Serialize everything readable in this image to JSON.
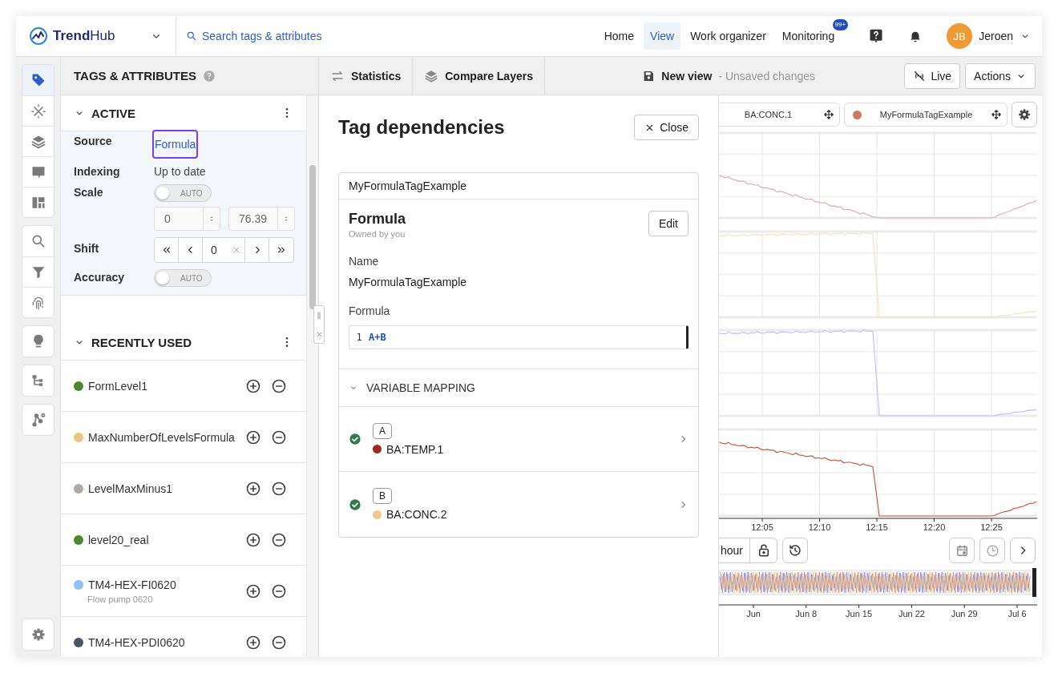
{
  "topbar": {
    "brand": "**Trend**Hub",
    "search": "Search tags & attributes",
    "nav": [
      {
        "label": "Home",
        "selected": false
      },
      {
        "label": "View",
        "selected": true
      },
      {
        "label": "Work organizer",
        "selected": false
      },
      {
        "label": "Monitoring",
        "selected": false,
        "badge": "99+"
      }
    ],
    "user": {
      "initials": "JB",
      "name": "Jeroen"
    }
  },
  "rail": {
    "groups": [
      [
        {
          "selected": true
        },
        {
          "selected": false
        },
        {
          "selected": false
        },
        {
          "selected": false
        },
        {
          "selected": false
        }
      ],
      [
        {
          "selected": false
        },
        {
          "selected": false
        },
        {
          "selected": false
        }
      ],
      [
        {
          "selected": false
        }
      ],
      [
        {
          "selected": false
        }
      ],
      [
        {
          "selected": false
        }
      ],
      [
        {
          "selected": false
        }
      ]
    ]
  },
  "tags_panel": {
    "title": "TAGS & ATTRIBUTES",
    "active": {
      "title": "ACTIVE",
      "expanded": true,
      "properties": [
        {
          "kind": "link",
          "label": "Source",
          "value": "Formula",
          "focused": true
        },
        {
          "kind": "text",
          "label": "Indexing",
          "value": "Up to date"
        },
        {
          "kind": "scale",
          "label": "Scale",
          "toggle": "AUTO",
          "on": false,
          "min": "0",
          "max": "76.39"
        },
        {
          "kind": "shift",
          "label": "Shift",
          "value": "0"
        },
        {
          "kind": "toggle",
          "label": "Accuracy",
          "toggle": "AUTO",
          "on": false
        }
      ]
    },
    "recent": {
      "title": "RECENTLY USED",
      "expanded": true,
      "items": [
        {
          "name": "FormLevel1",
          "color": "#4a8a2a"
        },
        {
          "name": "MaxNumberOfLevelsFormula",
          "color": "#e8c878"
        },
        {
          "name": "LevelMaxMinus1",
          "color": "#b0aaa6"
        },
        {
          "name": "level20_real",
          "color": "#4a8a2a"
        },
        {
          "name": "TM4-HEX-FI0620",
          "description": "Flow pump 0620",
          "color": "#8ec0f8"
        },
        {
          "name": "TM4-HEX-PDI0620",
          "color": "#4a5560"
        }
      ]
    }
  },
  "toolbar": {
    "tabs": [
      {
        "label": "Statistics"
      },
      {
        "label": "Compare Layers"
      }
    ],
    "view": {
      "name": "New view",
      "status": "- Unsaved changes"
    },
    "live": {
      "label": "Live",
      "on": false
    },
    "actions": "Actions"
  },
  "dependencies": {
    "title": "Tag dependencies",
    "close": "Close",
    "tag": "MyFormulaTagExample",
    "formula": {
      "title": "Formula",
      "owner": "Owned by you",
      "edit": "Edit",
      "fields": [
        {
          "label": "Name",
          "value": "MyFormulaTagExample"
        }
      ],
      "code_label": "Formula",
      "code": [
        {
          "number": "1",
          "text": "A+B"
        }
      ]
    },
    "mapping": {
      "title": "VARIABLE MAPPING",
      "expanded": true,
      "variables": [
        {
          "letter": "A",
          "tag": "BA:TEMP.1",
          "color": "#a3291c",
          "valid": true
        },
        {
          "letter": "B",
          "tag": "BA:CONC.2",
          "color": "#f3c98a",
          "valid": true
        }
      ]
    }
  },
  "trend": {
    "legend": [
      {
        "label": "BA:CONC.1"
      },
      {
        "label": "MyFormulaTagExample",
        "color": "#c97b68"
      }
    ],
    "x_ticks": [
      "12:05",
      "12:10",
      "12:15",
      "12:20",
      "12:25"
    ],
    "range": "hour",
    "overview_ticks": [
      "Jun",
      "Jun 8",
      "Jun 15",
      "Jun 22",
      "Jun 29",
      "Jul 6"
    ]
  }
}
